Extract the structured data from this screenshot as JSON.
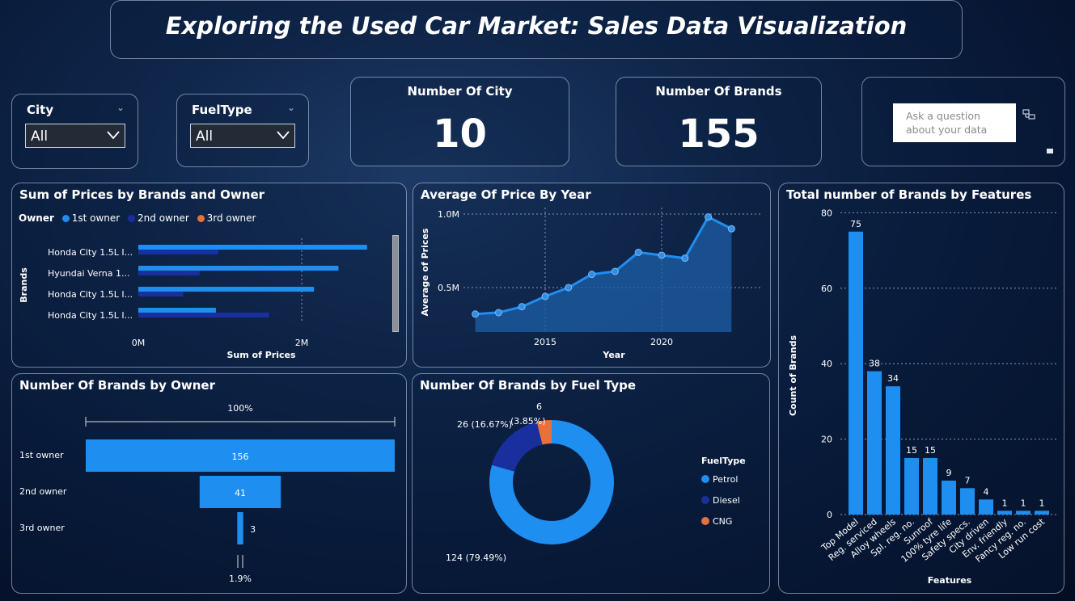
{
  "title": "Exploring the Used Car Market: Sales Data Visualization",
  "slicers": [
    {
      "label": "City",
      "value": "All"
    },
    {
      "label": "FuelType",
      "value": "All"
    }
  ],
  "cards": {
    "cities": {
      "label": "Number Of City",
      "value": "10"
    },
    "brands": {
      "label": "Number Of Brands",
      "value": "155"
    }
  },
  "qa": {
    "placeholder": "Ask a question about your data"
  },
  "colors": {
    "first": "#1f8ef1",
    "second": "#1a2f9e",
    "third": "#e8703a",
    "area": "#1e5fa8"
  },
  "charts": {
    "brands_owner": {
      "title": "Sum of Prices by Brands and Owner",
      "legend_title": "Owner",
      "legend": [
        "1st owner",
        "2nd owner",
        "3rd owner"
      ],
      "ylabel": "Brands",
      "xlabel": "Sum of Prices",
      "xticks": [
        "0M",
        "2M"
      ]
    },
    "price_year": {
      "title": "Average Of Price By Year",
      "ylabel": "Average of Prices",
      "xlabel": "Year",
      "yticks": [
        "1.0M",
        "0.5M"
      ],
      "xticks": [
        "2015",
        "2020"
      ]
    },
    "owner_funnel": {
      "title": "Number Of Brands by Owner",
      "top_pct": "100%",
      "bottom_pct": "1.9%"
    },
    "fuel_donut": {
      "title": "Number Of Brands by Fuel Type",
      "legend_title": "FuelType",
      "label_petrol": "124 (79.49%)",
      "label_diesel": "26 (16.67%)",
      "label_cng_top": "6",
      "label_cng": "(3.85%)"
    },
    "features": {
      "title": "Total number of Brands by Features",
      "ylabel": "Count of Brands",
      "xlabel": "Features",
      "yticks": [
        "80",
        "60",
        "40",
        "20",
        "0"
      ]
    }
  },
  "chart_data": [
    {
      "type": "bar",
      "orientation": "horizontal",
      "title": "Sum of Prices by Brands and Owner",
      "categories": [
        "Honda City 1.5L I...",
        "Hyundai Verna 1...",
        "Honda City 1.5L I...",
        "Honda City 1.5L I..."
      ],
      "series": [
        {
          "name": "1st owner",
          "values": [
            2.8,
            2.45,
            2.15,
            0.95
          ]
        },
        {
          "name": "2nd owner",
          "values": [
            0.98,
            0.75,
            0.55,
            1.6
          ]
        },
        {
          "name": "3rd owner",
          "values": [
            0,
            0,
            0,
            0
          ]
        }
      ],
      "xlabel": "Sum of Prices",
      "ylabel": "Brands",
      "xunit": "M",
      "xlim": [
        0,
        3.2
      ]
    },
    {
      "type": "area",
      "title": "Average Of Price By Year",
      "x": [
        2012,
        2013,
        2014,
        2015,
        2016,
        2017,
        2018,
        2019,
        2020,
        2021,
        2022,
        2023
      ],
      "values": [
        0.32,
        0.33,
        0.37,
        0.44,
        0.5,
        0.59,
        0.61,
        0.74,
        0.72,
        0.7,
        0.98,
        0.9
      ],
      "xlabel": "Year",
      "ylabel": "Average of Prices",
      "yunit": "M",
      "ylim": [
        0,
        1.05
      ]
    },
    {
      "type": "bar",
      "subtype": "funnel",
      "title": "Number Of Brands by Owner",
      "categories": [
        "1st owner",
        "2nd owner",
        "3rd owner"
      ],
      "values": [
        156,
        41,
        3
      ]
    },
    {
      "type": "pie",
      "subtype": "donut",
      "title": "Number Of Brands by Fuel Type",
      "categories": [
        "Petrol",
        "Diesel",
        "CNG"
      ],
      "values": [
        124,
        26,
        6
      ]
    },
    {
      "type": "bar",
      "title": "Total number of Brands by Features",
      "categories": [
        "Top Model",
        "Reg. serviced",
        "Alloy wheels",
        "Spl. reg. no.",
        "Sunroof",
        "100% tyre life",
        "Safety specs.",
        "City driven",
        "Env. friendly",
        "Fancy reg. no.",
        "Low run cost"
      ],
      "values": [
        75,
        38,
        34,
        15,
        15,
        9,
        7,
        4,
        1,
        1,
        1
      ],
      "xlabel": "Features",
      "ylabel": "Count of Brands",
      "ylim": [
        0,
        80
      ]
    }
  ]
}
